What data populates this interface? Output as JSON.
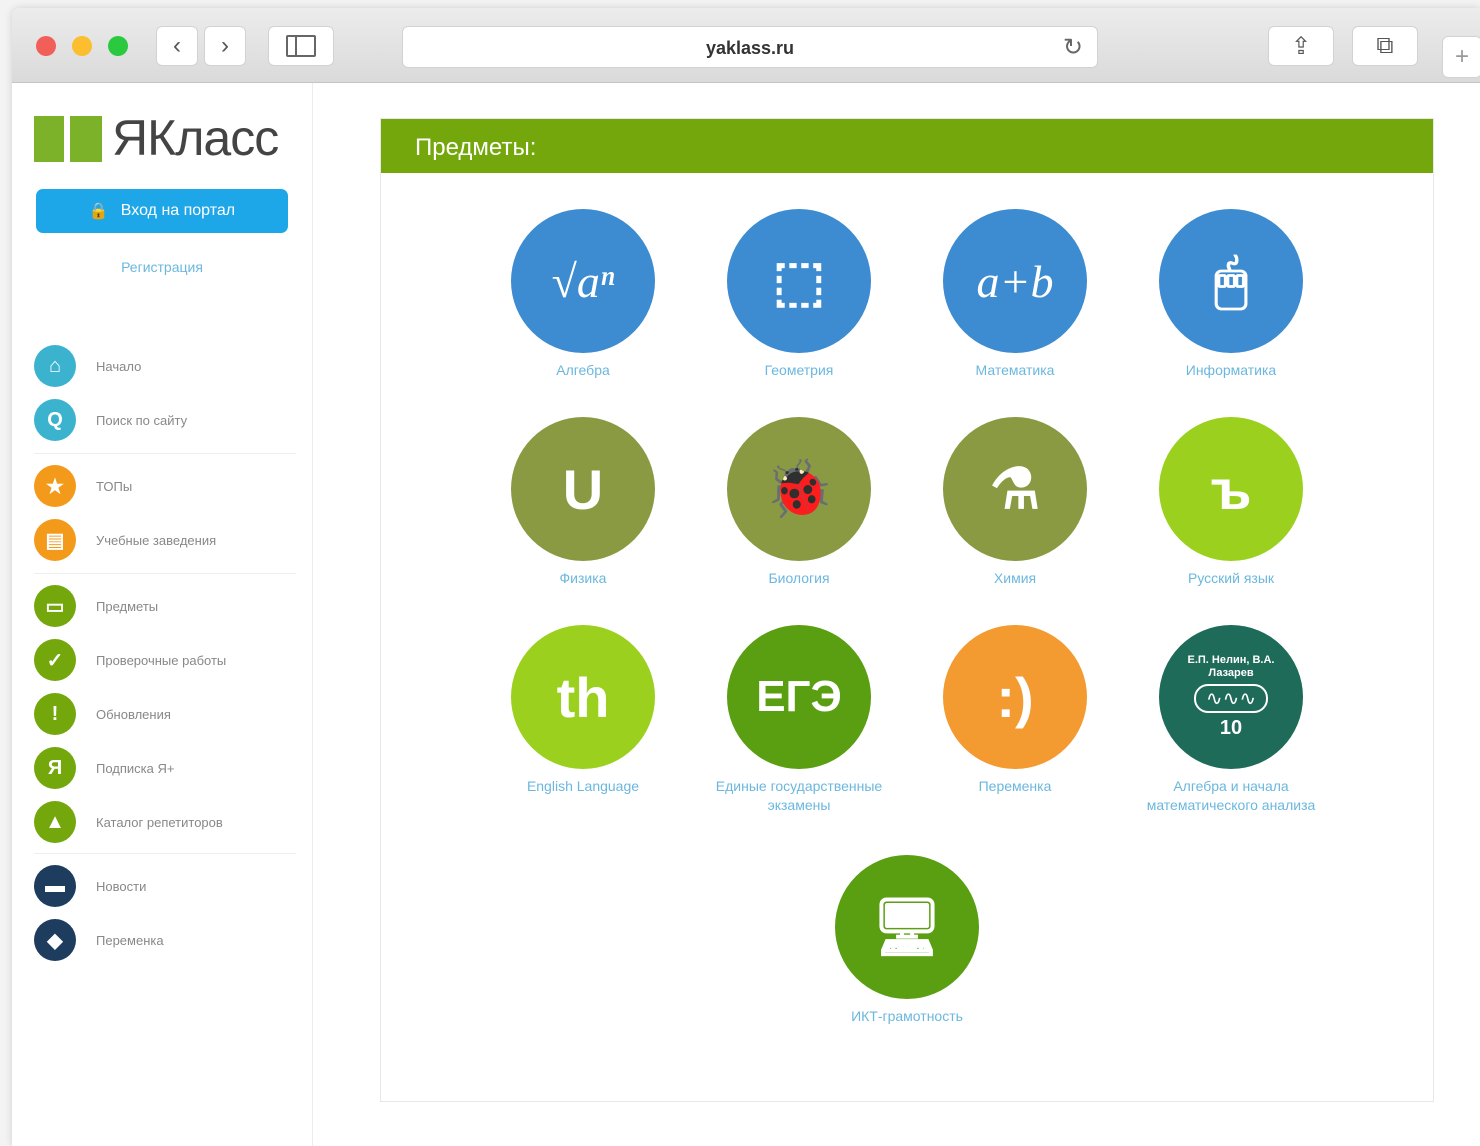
{
  "browser": {
    "url": "yaklass.ru",
    "buttons": {
      "back": "‹",
      "forward": "›",
      "reload": "↻",
      "share": "⇪",
      "tabs": "⧉",
      "new_tab": "+"
    }
  },
  "sidebar": {
    "logo_text": "ЯКласс",
    "login_button": "Вход на портал",
    "register_link": "Регистрация",
    "items": [
      {
        "label": "Начало",
        "icon": "home-icon",
        "color": "#3bb3cf",
        "glyph": "⌂"
      },
      {
        "label": "Поиск по сайту",
        "icon": "search-icon",
        "color": "#3bb3cf",
        "glyph": "Q"
      },
      {
        "label": "ТОПы",
        "icon": "star-icon",
        "color": "#f39a1b",
        "glyph": "★"
      },
      {
        "label": "Учебные заведения",
        "icon": "building-icon",
        "color": "#f39a1b",
        "glyph": "▤"
      },
      {
        "label": "Предметы",
        "icon": "book-icon",
        "color": "#73a70b",
        "glyph": "▭"
      },
      {
        "label": "Проверочные работы",
        "icon": "check-icon",
        "color": "#73a70b",
        "glyph": "✓"
      },
      {
        "label": "Обновления",
        "icon": "exclamation-icon",
        "color": "#73a70b",
        "glyph": "!"
      },
      {
        "label": "Подписка Я+",
        "icon": "ya-plus-icon",
        "color": "#73a70b",
        "glyph": "Я"
      },
      {
        "label": "Каталог репетиторов",
        "icon": "graduation-cap-icon",
        "color": "#73a70b",
        "glyph": "▲"
      },
      {
        "label": "Новости",
        "icon": "chat-icon",
        "color": "#1e3c5e",
        "glyph": "▬"
      },
      {
        "label": "Переменка",
        "icon": "shield-icon",
        "color": "#1e3c5e",
        "glyph": "◆"
      }
    ]
  },
  "main": {
    "header": "Предметы:",
    "subjects": [
      {
        "label": "Алгебра",
        "color": "#3d8bd0",
        "glyph": "√aⁿ",
        "icon": "sqrt-icon"
      },
      {
        "label": "Геометрия",
        "color": "#3d8bd0",
        "glyph": "⬚",
        "icon": "cube-icon"
      },
      {
        "label": "Математика",
        "color": "#3d8bd0",
        "glyph": "a+b",
        "icon": "a-plus-b-icon"
      },
      {
        "label": "Информатика",
        "color": "#3d8bd0",
        "glyph": "🖱",
        "icon": "mouse-icon"
      },
      {
        "label": "Физика",
        "color": "#8a9a43",
        "glyph": "U",
        "icon": "magnet-icon"
      },
      {
        "label": "Биология",
        "color": "#8a9a43",
        "glyph": "🐞",
        "icon": "bug-icon"
      },
      {
        "label": "Химия",
        "color": "#8a9a43",
        "glyph": "⚗",
        "icon": "flask-icon"
      },
      {
        "label": "Русский язык",
        "color": "#9bd11e",
        "glyph": "ъ",
        "icon": "speech-bubble-icon"
      },
      {
        "label": "English Language",
        "color": "#9bd11e",
        "glyph": "th",
        "icon": "th-bubble-icon"
      },
      {
        "label": "Единые государственные экзамены",
        "color": "#5a9e12",
        "glyph": "ЕГЭ",
        "icon": "ege-icon"
      },
      {
        "label": "Переменка",
        "color": "#f39a30",
        "glyph": ":)",
        "icon": "smile-icon"
      },
      {
        "label": "Алгебра и начала математического анализа",
        "color": "#1e6b5a",
        "glyph": "10",
        "icon": "textbook-icon",
        "cover_text": "Е.П. Нелин, В.А. Лазарев"
      },
      {
        "label": "ИКТ-грамотность",
        "color": "#5a9e12",
        "glyph": "🖥",
        "icon": "devices-icon"
      }
    ]
  }
}
